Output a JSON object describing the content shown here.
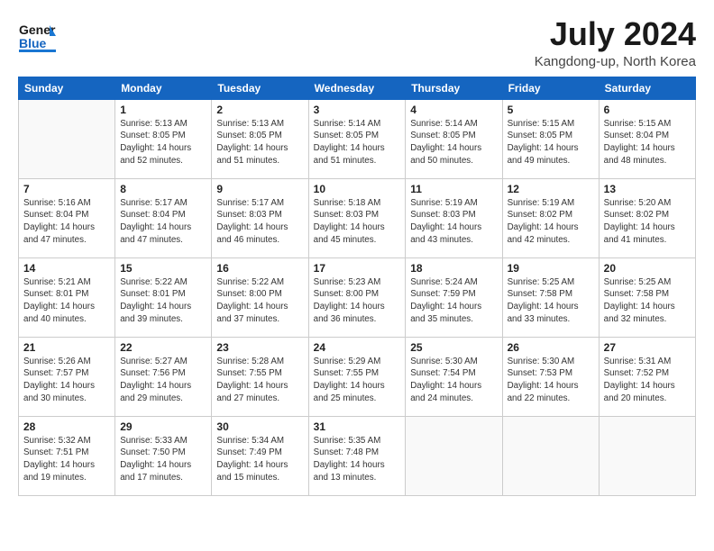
{
  "header": {
    "logo_line1": "General",
    "logo_line2": "Blue",
    "month": "July 2024",
    "location": "Kangdong-up, North Korea"
  },
  "weekdays": [
    "Sunday",
    "Monday",
    "Tuesday",
    "Wednesday",
    "Thursday",
    "Friday",
    "Saturday"
  ],
  "weeks": [
    [
      {
        "day": "",
        "info": ""
      },
      {
        "day": "1",
        "info": "Sunrise: 5:13 AM\nSunset: 8:05 PM\nDaylight: 14 hours\nand 52 minutes."
      },
      {
        "day": "2",
        "info": "Sunrise: 5:13 AM\nSunset: 8:05 PM\nDaylight: 14 hours\nand 51 minutes."
      },
      {
        "day": "3",
        "info": "Sunrise: 5:14 AM\nSunset: 8:05 PM\nDaylight: 14 hours\nand 51 minutes."
      },
      {
        "day": "4",
        "info": "Sunrise: 5:14 AM\nSunset: 8:05 PM\nDaylight: 14 hours\nand 50 minutes."
      },
      {
        "day": "5",
        "info": "Sunrise: 5:15 AM\nSunset: 8:05 PM\nDaylight: 14 hours\nand 49 minutes."
      },
      {
        "day": "6",
        "info": "Sunrise: 5:15 AM\nSunset: 8:04 PM\nDaylight: 14 hours\nand 48 minutes."
      }
    ],
    [
      {
        "day": "7",
        "info": "Sunrise: 5:16 AM\nSunset: 8:04 PM\nDaylight: 14 hours\nand 47 minutes."
      },
      {
        "day": "8",
        "info": "Sunrise: 5:17 AM\nSunset: 8:04 PM\nDaylight: 14 hours\nand 47 minutes."
      },
      {
        "day": "9",
        "info": "Sunrise: 5:17 AM\nSunset: 8:03 PM\nDaylight: 14 hours\nand 46 minutes."
      },
      {
        "day": "10",
        "info": "Sunrise: 5:18 AM\nSunset: 8:03 PM\nDaylight: 14 hours\nand 45 minutes."
      },
      {
        "day": "11",
        "info": "Sunrise: 5:19 AM\nSunset: 8:03 PM\nDaylight: 14 hours\nand 43 minutes."
      },
      {
        "day": "12",
        "info": "Sunrise: 5:19 AM\nSunset: 8:02 PM\nDaylight: 14 hours\nand 42 minutes."
      },
      {
        "day": "13",
        "info": "Sunrise: 5:20 AM\nSunset: 8:02 PM\nDaylight: 14 hours\nand 41 minutes."
      }
    ],
    [
      {
        "day": "14",
        "info": "Sunrise: 5:21 AM\nSunset: 8:01 PM\nDaylight: 14 hours\nand 40 minutes."
      },
      {
        "day": "15",
        "info": "Sunrise: 5:22 AM\nSunset: 8:01 PM\nDaylight: 14 hours\nand 39 minutes."
      },
      {
        "day": "16",
        "info": "Sunrise: 5:22 AM\nSunset: 8:00 PM\nDaylight: 14 hours\nand 37 minutes."
      },
      {
        "day": "17",
        "info": "Sunrise: 5:23 AM\nSunset: 8:00 PM\nDaylight: 14 hours\nand 36 minutes."
      },
      {
        "day": "18",
        "info": "Sunrise: 5:24 AM\nSunset: 7:59 PM\nDaylight: 14 hours\nand 35 minutes."
      },
      {
        "day": "19",
        "info": "Sunrise: 5:25 AM\nSunset: 7:58 PM\nDaylight: 14 hours\nand 33 minutes."
      },
      {
        "day": "20",
        "info": "Sunrise: 5:25 AM\nSunset: 7:58 PM\nDaylight: 14 hours\nand 32 minutes."
      }
    ],
    [
      {
        "day": "21",
        "info": "Sunrise: 5:26 AM\nSunset: 7:57 PM\nDaylight: 14 hours\nand 30 minutes."
      },
      {
        "day": "22",
        "info": "Sunrise: 5:27 AM\nSunset: 7:56 PM\nDaylight: 14 hours\nand 29 minutes."
      },
      {
        "day": "23",
        "info": "Sunrise: 5:28 AM\nSunset: 7:55 PM\nDaylight: 14 hours\nand 27 minutes."
      },
      {
        "day": "24",
        "info": "Sunrise: 5:29 AM\nSunset: 7:55 PM\nDaylight: 14 hours\nand 25 minutes."
      },
      {
        "day": "25",
        "info": "Sunrise: 5:30 AM\nSunset: 7:54 PM\nDaylight: 14 hours\nand 24 minutes."
      },
      {
        "day": "26",
        "info": "Sunrise: 5:30 AM\nSunset: 7:53 PM\nDaylight: 14 hours\nand 22 minutes."
      },
      {
        "day": "27",
        "info": "Sunrise: 5:31 AM\nSunset: 7:52 PM\nDaylight: 14 hours\nand 20 minutes."
      }
    ],
    [
      {
        "day": "28",
        "info": "Sunrise: 5:32 AM\nSunset: 7:51 PM\nDaylight: 14 hours\nand 19 minutes."
      },
      {
        "day": "29",
        "info": "Sunrise: 5:33 AM\nSunset: 7:50 PM\nDaylight: 14 hours\nand 17 minutes."
      },
      {
        "day": "30",
        "info": "Sunrise: 5:34 AM\nSunset: 7:49 PM\nDaylight: 14 hours\nand 15 minutes."
      },
      {
        "day": "31",
        "info": "Sunrise: 5:35 AM\nSunset: 7:48 PM\nDaylight: 14 hours\nand 13 minutes."
      },
      {
        "day": "",
        "info": ""
      },
      {
        "day": "",
        "info": ""
      },
      {
        "day": "",
        "info": ""
      }
    ]
  ]
}
